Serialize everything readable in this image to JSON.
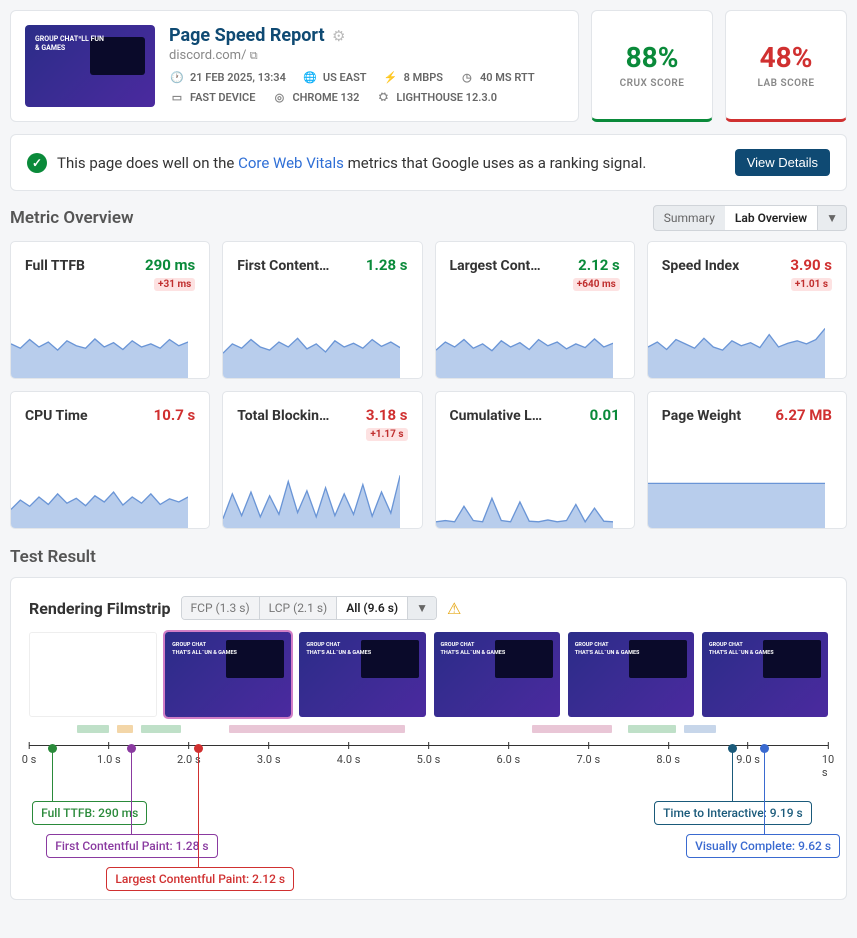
{
  "header": {
    "title": "Page Speed Report",
    "domain": "discord.com/",
    "meta": {
      "date": "21 FEB 2025, 13:34",
      "region": "US EAST",
      "bandwidth": "8 MBPS",
      "rtt": "40 MS RTT",
      "device": "FAST DEVICE",
      "browser": "CHROME 132",
      "tool": "LIGHTHOUSE 12.3.0"
    }
  },
  "scores": {
    "crux": {
      "value": "88%",
      "label": "CRUX SCORE"
    },
    "lab": {
      "value": "48%",
      "label": "LAB SCORE"
    }
  },
  "vitals": {
    "prefix": "This page does well on the ",
    "link": "Core Web Vitals",
    "suffix": " metrics that Google uses as a ranking signal.",
    "button": "View Details"
  },
  "overview": {
    "title": "Metric Overview",
    "toggle": {
      "summary": "Summary",
      "lab": "Lab Overview"
    }
  },
  "metrics": [
    {
      "name": "Full TTFB",
      "value": "290 ms",
      "color": "green",
      "delta": "+31 ms"
    },
    {
      "name": "First Contentf…",
      "value": "1.28 s",
      "color": "green",
      "delta": ""
    },
    {
      "name": "Largest Conte…",
      "value": "2.12 s",
      "color": "green",
      "delta": "+640 ms"
    },
    {
      "name": "Speed Index",
      "value": "3.90 s",
      "color": "red",
      "delta": "+1.01 s"
    },
    {
      "name": "CPU Time",
      "value": "10.7 s",
      "color": "red",
      "delta": ""
    },
    {
      "name": "Total Blocking …",
      "value": "3.18 s",
      "color": "red",
      "delta": "+1.17 s"
    },
    {
      "name": "Cumulative Lay…",
      "value": "0.01",
      "color": "green",
      "delta": ""
    },
    {
      "name": "Page Weight",
      "value": "6.27 MB",
      "color": "red",
      "delta": ""
    }
  ],
  "chart_data": {
    "note": "Sparkline series are approximate readings from small trend charts; values are relative (0-100 of mini-chart height).",
    "sparklines": [
      [
        55,
        48,
        62,
        50,
        58,
        45,
        60,
        52,
        48,
        63,
        50,
        57,
        46,
        60,
        50,
        55,
        48,
        62,
        52,
        58
      ],
      [
        40,
        55,
        48,
        62,
        50,
        45,
        58,
        50,
        64,
        47,
        55,
        42,
        60,
        50,
        56,
        48,
        62,
        51,
        58,
        49
      ],
      [
        45,
        58,
        50,
        62,
        48,
        55,
        44,
        60,
        50,
        57,
        46,
        62,
        52,
        58,
        47,
        55,
        49,
        63,
        50,
        56
      ],
      [
        50,
        58,
        46,
        62,
        55,
        48,
        64,
        50,
        45,
        60,
        52,
        57,
        49,
        70,
        50,
        56,
        60,
        55,
        62,
        80
      ],
      [
        30,
        45,
        35,
        50,
        38,
        55,
        40,
        48,
        36,
        52,
        42,
        58,
        37,
        50,
        40,
        55,
        38,
        47,
        42,
        50
      ],
      [
        15,
        55,
        20,
        58,
        18,
        52,
        22,
        75,
        25,
        60,
        18,
        65,
        20,
        55,
        22,
        70,
        19,
        58,
        24,
        85
      ],
      [
        10,
        12,
        10,
        35,
        12,
        10,
        48,
        12,
        10,
        42,
        11,
        10,
        13,
        10,
        12,
        38,
        10,
        32,
        11,
        10
      ],
      [
        72,
        72,
        72,
        72,
        72,
        72,
        72,
        72,
        72,
        72,
        72,
        72,
        72,
        72,
        72,
        72,
        72,
        72,
        72,
        72
      ]
    ]
  },
  "testresult": {
    "title": "Test Result"
  },
  "filmstrip": {
    "title": "Rendering Filmstrip",
    "pills": {
      "fcp": "FCP (1.3 s)",
      "lcp": "LCP (2.1 s)",
      "all": "All (9.6 s)"
    },
    "ticks": [
      "0 s",
      "1.0 s",
      "2.0 s",
      "3.0 s",
      "4.0 s",
      "5.0 s",
      "6.0 s",
      "7.0 s",
      "8.0 s",
      "9.0 s",
      "10 s"
    ],
    "markers": {
      "ttfb": "Full TTFB: 290 ms",
      "fcp": "First Contentful Paint: 1.28 s",
      "lcp": "Largest Contentful Paint: 2.12 s",
      "tti": "Time to Interactive: 9.19 s",
      "vc": "Visually Complete: 9.62 s"
    }
  }
}
